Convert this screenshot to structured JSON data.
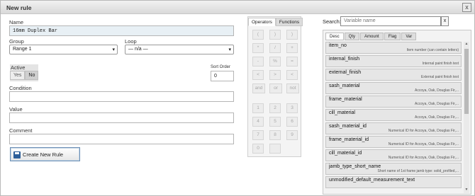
{
  "window": {
    "title": "New rule",
    "close_glyph": "x"
  },
  "form": {
    "name_label": "Name",
    "name_value": "16mm Duplex Bar",
    "group_label": "Group",
    "group_value": "Range 1",
    "loop_label": "Loop",
    "loop_value": "— n/a —",
    "active_label": "Active",
    "active_yes": "Yes",
    "active_no": "No",
    "sort_order_label": "Sort Order",
    "sort_order_value": "0",
    "condition_label": "Condition",
    "condition_value": "",
    "value_label": "Value",
    "value_value": "",
    "comment_label": "Comment",
    "comment_value": "",
    "create_button": "Create New Rule"
  },
  "calculator": {
    "tabs": [
      "Operators",
      "Functions"
    ],
    "operator_buttons": [
      "(",
      ")",
      ")",
      "*",
      "/",
      "+",
      "-",
      "%",
      "=",
      "<",
      ">",
      "<",
      "<=",
      ">=",
      "!=",
      "and",
      "or",
      "not"
    ],
    "digit_buttons": [
      "1",
      "2",
      "3",
      "4",
      "5",
      "6",
      "7",
      "8",
      "9",
      "0",
      ""
    ]
  },
  "variables": {
    "search_label": "Search:",
    "search_placeholder": "Variable name",
    "search_clear": "x",
    "tabs": [
      "Desc",
      "Qty",
      "Amount",
      "Flag",
      "Var"
    ],
    "items": [
      {
        "name": "item_no",
        "desc": "Item number (can contain letters)"
      },
      {
        "name": "internal_finish",
        "desc": "Internal paint finish text"
      },
      {
        "name": "external_finish",
        "desc": "External paint finish text"
      },
      {
        "name": "sash_material",
        "desc": "Accoya, Oak, Douglas Fir,..."
      },
      {
        "name": "frame_material",
        "desc": "Accoya, Oak, Douglas Fir,..."
      },
      {
        "name": "cill_material",
        "desc": "Accoya, Oak, Douglas Fir,..."
      },
      {
        "name": "sash_material_id",
        "desc": "Numerical ID for Accoya, Oak, Douglas Fir,..."
      },
      {
        "name": "frame_material_id",
        "desc": "Numerical ID for Accoya, Oak, Douglas Fir,..."
      },
      {
        "name": "cill_material_id",
        "desc": "Numerical ID for Accoya, Oak, Douglas Fir,..."
      },
      {
        "name": "jamb_type_short_name",
        "desc": "Short name of 1st frame jamb type: solid_profiled,..."
      },
      {
        "name": "unmodified_default_measurement_text",
        "desc": ""
      }
    ]
  }
}
